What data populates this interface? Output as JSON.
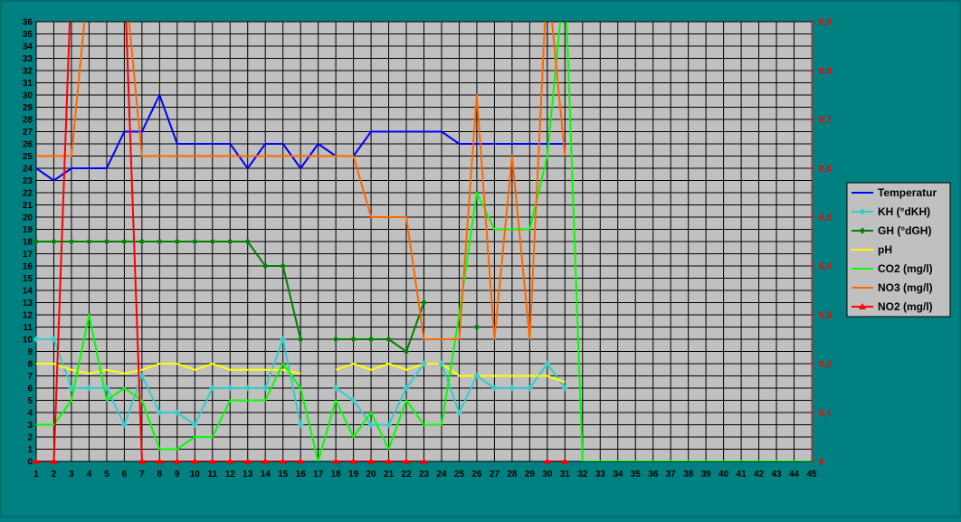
{
  "chart_data": {
    "type": "line",
    "title": "",
    "xlabel": "",
    "ylabel": "",
    "y2label": "",
    "x": [
      1,
      2,
      3,
      4,
      5,
      6,
      7,
      8,
      9,
      10,
      11,
      12,
      13,
      14,
      15,
      16,
      17,
      18,
      19,
      20,
      21,
      22,
      23,
      24,
      25,
      26,
      27,
      28,
      29,
      30,
      31,
      32,
      33,
      34,
      35,
      36,
      37,
      38,
      39,
      40,
      41,
      42,
      43,
      44,
      45
    ],
    "xlim": [
      1,
      45
    ],
    "ylim": [
      0,
      36
    ],
    "y_ticks": [
      "0",
      "1",
      "2",
      "3",
      "4",
      "5",
      "6",
      "7",
      "8",
      "9",
      "10",
      "11",
      "12",
      "13",
      "14",
      "15",
      "16",
      "17",
      "18",
      "19",
      "20",
      "21",
      "22",
      "23",
      "24",
      "25",
      "26",
      "27",
      "28",
      "29",
      "30",
      "31",
      "32",
      "33",
      "34",
      "35",
      "36"
    ],
    "y2lim": [
      0,
      0.9
    ],
    "y2_ticks": [
      "0",
      "0,1",
      "0,2",
      "0,3",
      "0,4",
      "0,5",
      "0,6",
      "0,7",
      "0,8",
      "0,9"
    ],
    "grid": true,
    "legend_position": "right",
    "plot_background": "#c0c0c0",
    "series": [
      {
        "name": "Temperatur",
        "axis": "left",
        "color": "#0000ff",
        "marker": "none",
        "values": [
          24,
          23,
          24,
          24,
          24,
          27,
          27,
          30,
          26,
          26,
          26,
          26,
          24,
          26,
          26,
          24,
          26,
          25,
          25,
          27,
          27,
          27,
          27,
          27,
          26,
          26,
          26,
          26,
          26,
          26,
          26,
          null,
          null,
          null,
          null,
          null,
          null,
          null,
          null,
          null,
          null,
          null,
          null,
          null,
          null
        ]
      },
      {
        "name": "KH (°dKH)",
        "axis": "left",
        "color": "#33cccc",
        "marker": "diamond",
        "values": [
          10,
          10,
          6,
          6,
          6,
          3,
          7,
          4,
          4,
          3,
          6,
          6,
          6,
          6,
          10,
          3,
          null,
          6,
          5,
          3,
          3,
          6,
          8,
          8,
          4,
          7,
          6,
          6,
          6,
          8,
          6,
          null,
          null,
          null,
          null,
          null,
          null,
          null,
          null,
          null,
          null,
          null,
          null,
          null,
          null
        ]
      },
      {
        "name": "GH (°dGH)",
        "axis": "left",
        "color": "#008000",
        "marker": "diamond",
        "values": [
          18,
          18,
          18,
          18,
          18,
          18,
          18,
          18,
          18,
          18,
          18,
          18,
          18,
          16,
          16,
          10,
          null,
          10,
          10,
          10,
          10,
          9,
          13,
          null,
          null,
          11,
          null,
          null,
          null,
          null,
          null,
          null,
          null,
          null,
          null,
          null,
          null,
          null,
          null,
          null,
          null,
          null,
          null,
          null,
          null
        ]
      },
      {
        "name": "pH",
        "axis": "left",
        "color": "#ffff00",
        "marker": "none",
        "values": [
          8,
          8,
          7.5,
          7.2,
          7.5,
          7.2,
          7.5,
          8,
          8,
          7.5,
          8,
          7.5,
          7.5,
          7.5,
          7.5,
          7.2,
          null,
          7.5,
          8,
          7.5,
          8,
          7.5,
          8,
          8,
          7,
          7,
          7,
          7,
          7,
          7,
          6.5,
          null,
          null,
          null,
          null,
          null,
          null,
          null,
          null,
          null,
          null,
          null,
          null,
          null,
          null
        ]
      },
      {
        "name": "CO2 (mg/l)",
        "axis": "left",
        "color": "#00ff00",
        "marker": "none",
        "values": [
          3,
          3,
          5,
          12,
          5,
          6,
          5,
          1,
          1,
          2,
          2,
          5,
          5,
          5,
          8,
          6,
          0,
          5,
          2,
          4,
          1,
          5,
          3,
          3,
          12,
          22,
          19,
          19,
          19,
          25,
          40,
          0,
          0,
          0,
          0,
          0,
          0,
          0,
          0,
          0,
          0,
          0,
          0,
          0,
          0
        ]
      },
      {
        "name": "NO3 (mg/l)",
        "axis": "right",
        "color": "#ff6600",
        "marker": "none",
        "values": [
          0.625,
          0.625,
          0.625,
          1.0,
          1.0,
          1.0,
          0.625,
          0.625,
          0.625,
          0.625,
          0.625,
          0.625,
          0.625,
          0.625,
          0.625,
          0.625,
          0.625,
          0.625,
          0.625,
          0.5,
          0.5,
          0.5,
          0.25,
          0.25,
          0.25,
          0.75,
          0.25,
          0.625,
          0.25,
          1.0,
          0.625,
          null,
          null,
          null,
          null,
          null,
          null,
          null,
          null,
          null,
          null,
          null,
          null,
          null,
          null
        ]
      },
      {
        "name": "NO2 (mg/l)",
        "axis": "right",
        "color": "#ff0000",
        "marker": "triangle",
        "values": [
          0,
          0,
          1.0,
          null,
          null,
          1.0,
          0,
          0,
          0,
          0,
          0,
          0,
          0,
          0,
          0,
          0,
          null,
          0,
          0,
          0,
          0,
          0,
          0,
          null,
          null,
          null,
          null,
          null,
          null,
          0,
          0,
          null,
          null,
          null,
          null,
          null,
          null,
          null,
          null,
          null,
          null,
          null,
          null,
          null,
          null
        ]
      }
    ]
  }
}
